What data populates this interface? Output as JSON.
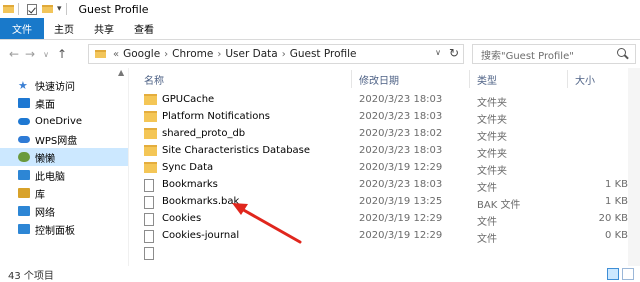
{
  "window": {
    "title": "Guest Profile"
  },
  "ribbon": {
    "tabs": [
      "文件",
      "主页",
      "共享",
      "查看"
    ]
  },
  "address": {
    "crumbs": [
      "Google",
      "Chrome",
      "User Data",
      "Guest Profile"
    ],
    "prefix": "«",
    "search_placeholder": "搜索\"Guest Profile\""
  },
  "nav": {
    "items": [
      {
        "label": "快速访问",
        "icon": "star-icon"
      },
      {
        "label": "桌面",
        "icon": "desktop-icon",
        "color": "#1e78d2"
      },
      {
        "label": "OneDrive",
        "icon": "cloud-icon",
        "color": "#1e78d2"
      },
      {
        "label": "WPS网盘",
        "icon": "cloud-icon",
        "color": "#2e7bd6"
      },
      {
        "label": "懒懒",
        "icon": "user-icon",
        "color": "#6a9a3c"
      },
      {
        "label": "此电脑",
        "icon": "computer-icon",
        "color": "#2d86d5"
      },
      {
        "label": "库",
        "icon": "library-icon",
        "color": "#d8a22a"
      },
      {
        "label": "网络",
        "icon": "network-icon",
        "color": "#2d86d5"
      },
      {
        "label": "控制面板",
        "icon": "control-panel-icon",
        "color": "#2d86d5"
      }
    ]
  },
  "list": {
    "columns": {
      "name": "名称",
      "date": "修改日期",
      "type": "类型",
      "size": "大小"
    },
    "rows": [
      {
        "name": "GPUCache",
        "date": "2020/3/23 18:03",
        "type": "文件夹",
        "size": "",
        "kind": "folder"
      },
      {
        "name": "Platform Notifications",
        "date": "2020/3/23 18:03",
        "type": "文件夹",
        "size": "",
        "kind": "folder"
      },
      {
        "name": "shared_proto_db",
        "date": "2020/3/23 18:02",
        "type": "文件夹",
        "size": "",
        "kind": "folder"
      },
      {
        "name": "Site Characteristics Database",
        "date": "2020/3/23 18:03",
        "type": "文件夹",
        "size": "",
        "kind": "folder"
      },
      {
        "name": "Sync Data",
        "date": "2020/3/19 12:29",
        "type": "文件夹",
        "size": "",
        "kind": "folder"
      },
      {
        "name": "Bookmarks",
        "date": "2020/3/23 18:03",
        "type": "文件",
        "size": "1 KB",
        "kind": "file"
      },
      {
        "name": "Bookmarks.bak",
        "date": "2020/3/19 13:25",
        "type": "BAK 文件",
        "size": "1 KB",
        "kind": "file"
      },
      {
        "name": "Cookies",
        "date": "2020/3/19 12:29",
        "type": "文件",
        "size": "20 KB",
        "kind": "file"
      },
      {
        "name": "Cookies-journal",
        "date": "2020/3/19 12:29",
        "type": "文件",
        "size": "0 KB",
        "kind": "file"
      }
    ]
  },
  "status": {
    "text": "43 个项目"
  },
  "accent": "#1979ca",
  "annotation_color": "#e0261d"
}
